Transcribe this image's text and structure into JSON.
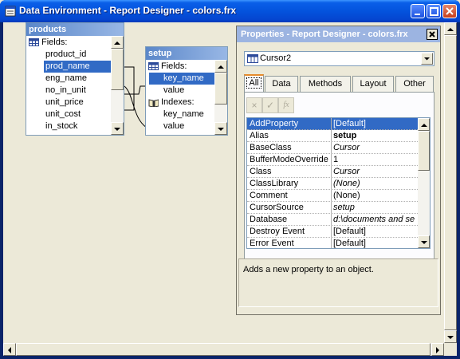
{
  "window": {
    "title": "Data Environment - Report Designer - colors.frx"
  },
  "cursors": {
    "products": {
      "title": "products",
      "fields_label": "Fields:",
      "fields": [
        "product_id",
        "prod_name",
        "eng_name",
        "no_in_unit",
        "unit_price",
        "unit_cost",
        "in_stock"
      ],
      "selected_field": "prod_name"
    },
    "setup": {
      "title": "setup",
      "fields_label": "Fields:",
      "fields": [
        "key_name",
        "value"
      ],
      "selected_field": "key_name",
      "indexes_label": "Indexes:",
      "indexes": [
        "key_name",
        "value"
      ]
    }
  },
  "properties": {
    "title": "Properties - Report Designer - colors.frx",
    "object_selector": "Cursor2",
    "tabs": [
      "All",
      "Data",
      "Methods",
      "Layout",
      "Other"
    ],
    "active_tab": "All",
    "toolbar": {
      "cancel_icon": "×",
      "accept_icon": "✓",
      "fx_icon": "fx"
    },
    "rows": [
      {
        "name": "AddProperty",
        "value": "[Default]",
        "style": "normal",
        "selected": true
      },
      {
        "name": "Alias",
        "value": "setup",
        "style": "bold"
      },
      {
        "name": "BaseClass",
        "value": "Cursor",
        "style": "italic"
      },
      {
        "name": "BufferModeOverride",
        "value": "1",
        "style": "normal"
      },
      {
        "name": "Class",
        "value": "Cursor",
        "style": "italic"
      },
      {
        "name": "ClassLibrary",
        "value": "(None)",
        "style": "italic"
      },
      {
        "name": "Comment",
        "value": "(None)",
        "style": "normal"
      },
      {
        "name": "CursorSource",
        "value": "setup",
        "style": "italic"
      },
      {
        "name": "Database",
        "value": "d:\\documents and se",
        "style": "italic"
      },
      {
        "name": "Destroy Event",
        "value": "[Default]",
        "style": "normal"
      },
      {
        "name": "Error Event",
        "value": "[Default]",
        "style": "normal"
      }
    ],
    "description": "Adds a new property to an object."
  },
  "colors": {
    "title_blue": "#0453dd",
    "selection": "#316ac5",
    "cursor_title": "#5b87c9",
    "props_title_inactive": "#9cb4e1",
    "tab_highlight": "#e68b2c",
    "desktop": "#ece9d8"
  },
  "icons": {
    "app": "report-designer-icon",
    "fields": "grid-icon",
    "indexes": "book-icon",
    "selector": "cursor-object-icon"
  }
}
